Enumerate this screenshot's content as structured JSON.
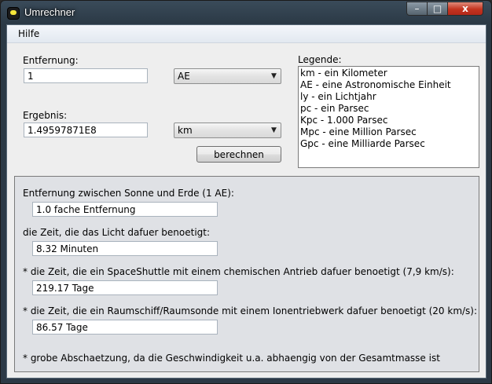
{
  "window": {
    "title": "Umrechner",
    "controls": {
      "minimize": "–",
      "maximize": "□",
      "close": "x"
    }
  },
  "menu": {
    "items": [
      {
        "label": "Hilfe"
      }
    ]
  },
  "input": {
    "distance_label": "Entfernung:",
    "distance_value": "1",
    "from_unit_selected": "AE",
    "result_label": "Ergebnis:",
    "result_value": "1.49597871E8",
    "to_unit_selected": "km",
    "calculate_button": "berechnen"
  },
  "legend": {
    "title": "Legende:",
    "items": [
      "km - ein Kilometer",
      "AE - eine Astronomische Einheit",
      "ly - ein Lichtjahr",
      "pc - ein Parsec",
      "Kpc - 1.000 Parsec",
      "Mpc - eine Million Parsec",
      "Gpc - eine Milliarde Parsec"
    ]
  },
  "info": {
    "rows": [
      {
        "label": "Entfernung zwischen Sonne und Erde (1 AE):",
        "value": "1.0 fache Entfernung"
      },
      {
        "label": "die Zeit, die das Licht dafuer benoetigt:",
        "value": "8.32 Minuten"
      },
      {
        "label": "* die Zeit, die ein SpaceShuttle mit einem chemischen Antrieb dafuer benoetigt (7,9 km/s):",
        "value": "219.17 Tage"
      },
      {
        "label": "* die Zeit, die ein Raumschiff/Raumsonde mit einem Ionentriebwerk dafuer benoetigt (20 km/s):",
        "value": "86.57 Tage"
      }
    ],
    "footnote": "* grobe Abschaetzung, da die Geschwindigkeit u.a. abhaengig von der Gesamtmasse ist"
  },
  "icons": {
    "app": "app-icon",
    "dropdown": "chevron-down-icon"
  }
}
